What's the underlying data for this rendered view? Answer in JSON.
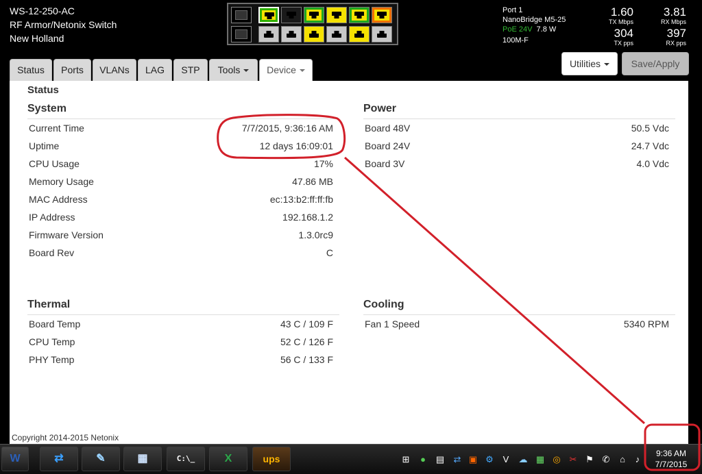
{
  "device": {
    "name": "WS-12-250-AC",
    "model": "RF Armor/Netonix Switch",
    "location": "New Holland"
  },
  "port_info": {
    "port": "Port 1",
    "device": "NanoBridge M5-25",
    "poe_label": "PoE 24V",
    "poe_power": "7.8 W",
    "link": "100M-F"
  },
  "stats": {
    "tx_mbps": "1.60",
    "tx_mbps_label": "TX Mbps",
    "rx_mbps": "3.81",
    "rx_mbps_label": "RX Mbps",
    "tx_pps": "304",
    "tx_pps_label": "TX pps",
    "rx_pps": "397",
    "rx_pps_label": "RX pps"
  },
  "tabs": [
    {
      "label": "Status"
    },
    {
      "label": "Ports"
    },
    {
      "label": "VLANs"
    },
    {
      "label": "LAG"
    },
    {
      "label": "STP"
    },
    {
      "label": "Tools"
    },
    {
      "label": "Device"
    }
  ],
  "buttons": {
    "utilities": "Utilities",
    "save": "Save/Apply"
  },
  "page_title": "Status",
  "system": {
    "title": "System",
    "rows": [
      {
        "k": "Current Time",
        "v": "7/7/2015, 9:36:16 AM"
      },
      {
        "k": "Uptime",
        "v": "12 days 16:09:01"
      },
      {
        "k": "CPU Usage",
        "v": "17%"
      },
      {
        "k": "Memory Usage",
        "v": "47.86 MB"
      },
      {
        "k": "MAC Address",
        "v": "ec:13:b2:ff:ff:fb"
      },
      {
        "k": "IP Address",
        "v": "192.168.1.2"
      },
      {
        "k": "Firmware Version",
        "v": "1.3.0rc9"
      },
      {
        "k": "Board Rev",
        "v": "C"
      }
    ]
  },
  "power": {
    "title": "Power",
    "rows": [
      {
        "k": "Board 48V",
        "v": "50.5 Vdc"
      },
      {
        "k": "Board 24V",
        "v": "24.7 Vdc"
      },
      {
        "k": "Board 3V",
        "v": "4.0 Vdc"
      }
    ]
  },
  "thermal": {
    "title": "Thermal",
    "rows": [
      {
        "k": "Board Temp",
        "v": "43 C / 109 F"
      },
      {
        "k": "CPU Temp",
        "v": "52 C / 126 F"
      },
      {
        "k": "PHY Temp",
        "v": "56 C / 133 F"
      }
    ]
  },
  "cooling": {
    "title": "Cooling",
    "rows": [
      {
        "k": "Fan 1 Speed",
        "v": "5340 RPM"
      }
    ]
  },
  "copyright": "Copyright 2014-2015 Netonix",
  "taskbar": {
    "apps": [
      {
        "icon": "word-icon",
        "glyph": "W"
      },
      {
        "icon": "teamviewer-icon",
        "glyph": "⇄"
      },
      {
        "icon": "notepad-icon",
        "glyph": "✎"
      },
      {
        "icon": "calculator-icon",
        "glyph": "▦"
      },
      {
        "icon": "cmd-icon",
        "glyph": "C:\\_"
      },
      {
        "icon": "excel-icon",
        "glyph": "X"
      },
      {
        "icon": "ups-icon",
        "glyph": "ups"
      }
    ],
    "clock_time": "9:36 AM",
    "clock_date": "7/7/2015"
  },
  "colors": {
    "annotation": "#d2202a",
    "poe_green": "#33bb33",
    "port_yellow": "#f5e100"
  }
}
